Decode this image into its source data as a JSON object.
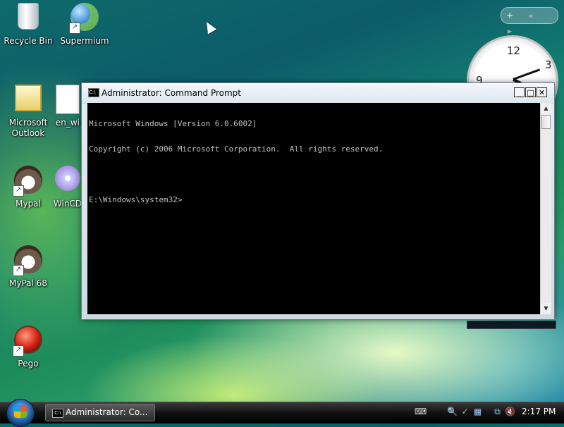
{
  "desktop": {
    "icons": [
      {
        "label": "Recycle Bin",
        "icon": "recycle-bin-icon"
      },
      {
        "label": "Supermium",
        "icon": "supermium-icon",
        "shortcut": true
      },
      {
        "label": "Microsoft Outlook",
        "icon": "outlook-icon"
      },
      {
        "label": "en_wi",
        "icon": "document-icon"
      },
      {
        "label": "Mypal",
        "icon": "mypal-icon",
        "shortcut": true
      },
      {
        "label": "WinCD",
        "icon": "disc-icon"
      },
      {
        "label": "MyPal 68",
        "icon": "mypal-icon",
        "shortcut": true
      },
      {
        "label": "Pego",
        "icon": "pego-icon",
        "shortcut": true
      }
    ]
  },
  "gadgets": {
    "add_label": "+",
    "prev_label": "◂",
    "next_label": "▸",
    "clock_numbers": [
      "12",
      "9",
      "3"
    ]
  },
  "cmd_window": {
    "title": "Administrator: Command Prompt",
    "app_icon_text": "C:\\",
    "lines": [
      "Microsoft Windows [Version 6.0.6002]",
      "Copyright (c) 2006 Microsoft Corporation.  All rights reserved.",
      "",
      "E:\\Windows\\system32>"
    ],
    "minimize_label": "_",
    "maximize_label": "□",
    "close_label": "✕"
  },
  "taskbar": {
    "task_button_label": "Administrator: Co...",
    "app_icon_text": "C:\\",
    "time": "2:17 PM"
  },
  "colors": {
    "console_bg": "#000000",
    "console_fg": "#c0c0c0",
    "taskbar_bg": "#111111"
  }
}
